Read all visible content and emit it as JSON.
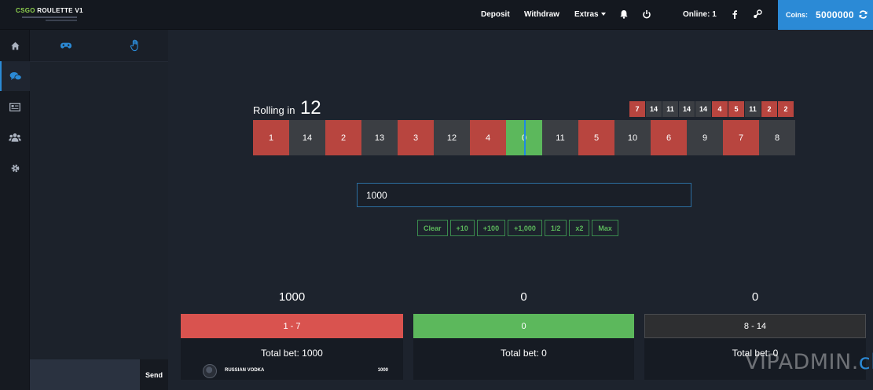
{
  "header": {
    "logo_title_accent": "CSGO",
    "logo_title_rest": "ROULETTE V1",
    "nav": {
      "deposit": "Deposit",
      "withdraw": "Withdraw",
      "extras": "Extras",
      "online": "Online: 1"
    },
    "coins_label": "Coins:",
    "coins_value": "5000000"
  },
  "icons": {
    "sidebar": [
      "home-icon",
      "chat-icon",
      "list-icon",
      "users-icon",
      "gear-icon"
    ],
    "chat_tabs": [
      "gamepad-icon",
      "hand-icon"
    ],
    "topbar": [
      "bell-icon",
      "power-icon",
      "facebook-icon",
      "steam-icon",
      "refresh-icon"
    ]
  },
  "chat": {
    "send_label": "Send",
    "input_value": ""
  },
  "roll": {
    "label": "Rolling in",
    "countdown": "12"
  },
  "history": [
    {
      "n": "7",
      "color": "red"
    },
    {
      "n": "14",
      "color": "black"
    },
    {
      "n": "11",
      "color": "black"
    },
    {
      "n": "14",
      "color": "black"
    },
    {
      "n": "14",
      "color": "black"
    },
    {
      "n": "4",
      "color": "red"
    },
    {
      "n": "5",
      "color": "red"
    },
    {
      "n": "11",
      "color": "black"
    },
    {
      "n": "2",
      "color": "red"
    },
    {
      "n": "2",
      "color": "red"
    }
  ],
  "wheel": [
    {
      "n": "1",
      "color": "red"
    },
    {
      "n": "14",
      "color": "black"
    },
    {
      "n": "2",
      "color": "red"
    },
    {
      "n": "13",
      "color": "black"
    },
    {
      "n": "3",
      "color": "red"
    },
    {
      "n": "12",
      "color": "black"
    },
    {
      "n": "4",
      "color": "red"
    },
    {
      "n": "0",
      "color": "green"
    },
    {
      "n": "11",
      "color": "black"
    },
    {
      "n": "5",
      "color": "red"
    },
    {
      "n": "10",
      "color": "black"
    },
    {
      "n": "6",
      "color": "red"
    },
    {
      "n": "9",
      "color": "black"
    },
    {
      "n": "7",
      "color": "red"
    },
    {
      "n": "8",
      "color": "black"
    }
  ],
  "bet_amount": "1000",
  "quick_buttons": [
    "Clear",
    "+10",
    "+100",
    "+1,000",
    "1/2",
    "x2",
    "Max"
  ],
  "columns": [
    {
      "total": "1000",
      "button_label": "1 - 7",
      "total_bet": "Total bet: 1000",
      "bets": [
        {
          "name": "RUSSIAN VODKA",
          "amount": "1000"
        }
      ]
    },
    {
      "total": "0",
      "button_label": "0",
      "total_bet": "Total bet: 0",
      "bets": []
    },
    {
      "total": "0",
      "button_label": "8 - 14",
      "total_bet": "Total bet: 0",
      "bets": []
    }
  ],
  "colors": {
    "red": "#b8453f",
    "black": "#3b3e43",
    "green": "#5cb85c",
    "accent": "#2b8ad6"
  },
  "watermark": {
    "main": "VIPADMIN.",
    "accent": "club"
  }
}
